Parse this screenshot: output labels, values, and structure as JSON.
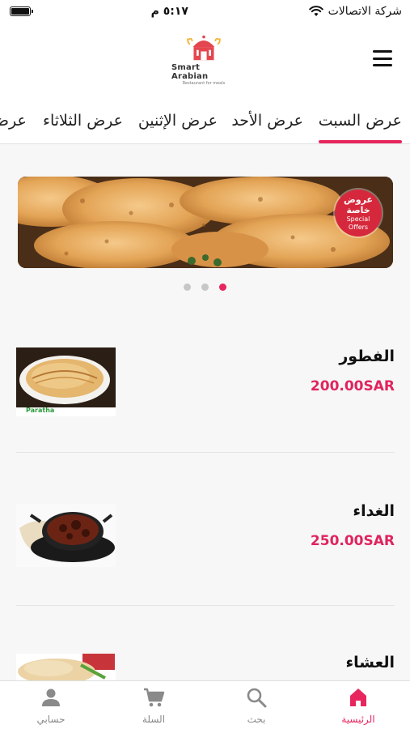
{
  "status": {
    "carrier": "شركة الاتصالات",
    "time": "٥:١٧ م"
  },
  "header": {
    "logo_title": "Smart Arabian",
    "logo_subtitle": "Restaurant for meals"
  },
  "tabs": [
    {
      "label": "عرض السبت",
      "active": true
    },
    {
      "label": "عرض الأحد",
      "active": false
    },
    {
      "label": "عرض الإثنين",
      "active": false
    },
    {
      "label": "عرض الثلاثاء",
      "active": false
    },
    {
      "label": "عرض",
      "active": false
    }
  ],
  "banner": {
    "badge_line1": "عروض",
    "badge_line2": "خاصة",
    "badge_line3": "Special",
    "badge_line4": "Offers",
    "slides": 3,
    "active_slide": 3
  },
  "meals": [
    {
      "title": "الفطور",
      "price": "200.00SAR",
      "image_caption": "Paratha"
    },
    {
      "title": "الغداء",
      "price": "250.00SAR",
      "image_caption": ""
    },
    {
      "title": "العشاء",
      "price": "",
      "image_caption": ""
    }
  ],
  "bottom_nav": [
    {
      "label": "حسابي",
      "icon": "person-icon",
      "active": false
    },
    {
      "label": "السلة",
      "icon": "cart-icon",
      "active": false
    },
    {
      "label": "بحث",
      "icon": "search-icon",
      "active": false
    },
    {
      "label": "الرئيسية",
      "icon": "home-icon",
      "active": true
    }
  ],
  "colors": {
    "accent": "#e8265e",
    "price": "#e0245e"
  }
}
